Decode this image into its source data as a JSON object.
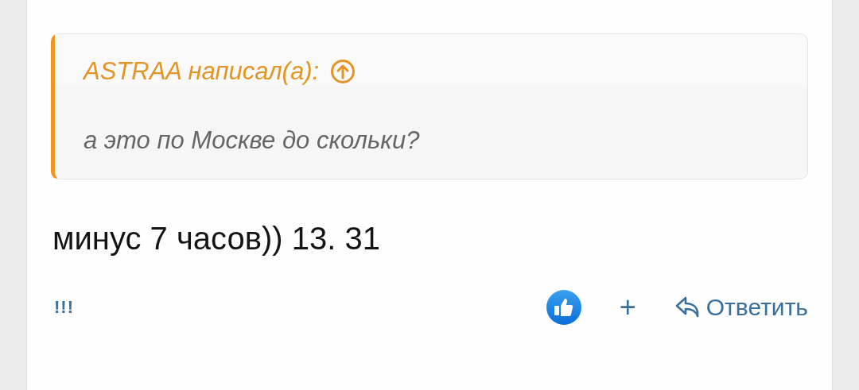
{
  "quote": {
    "author_line": "ASTRAA написал(а):",
    "text": "а это по Москве до скольки?"
  },
  "message": {
    "text": "минус 7 часов)) 13. 31"
  },
  "footer": {
    "report_link": "!!!",
    "add_label": "+",
    "reply_label": "Ответить"
  }
}
